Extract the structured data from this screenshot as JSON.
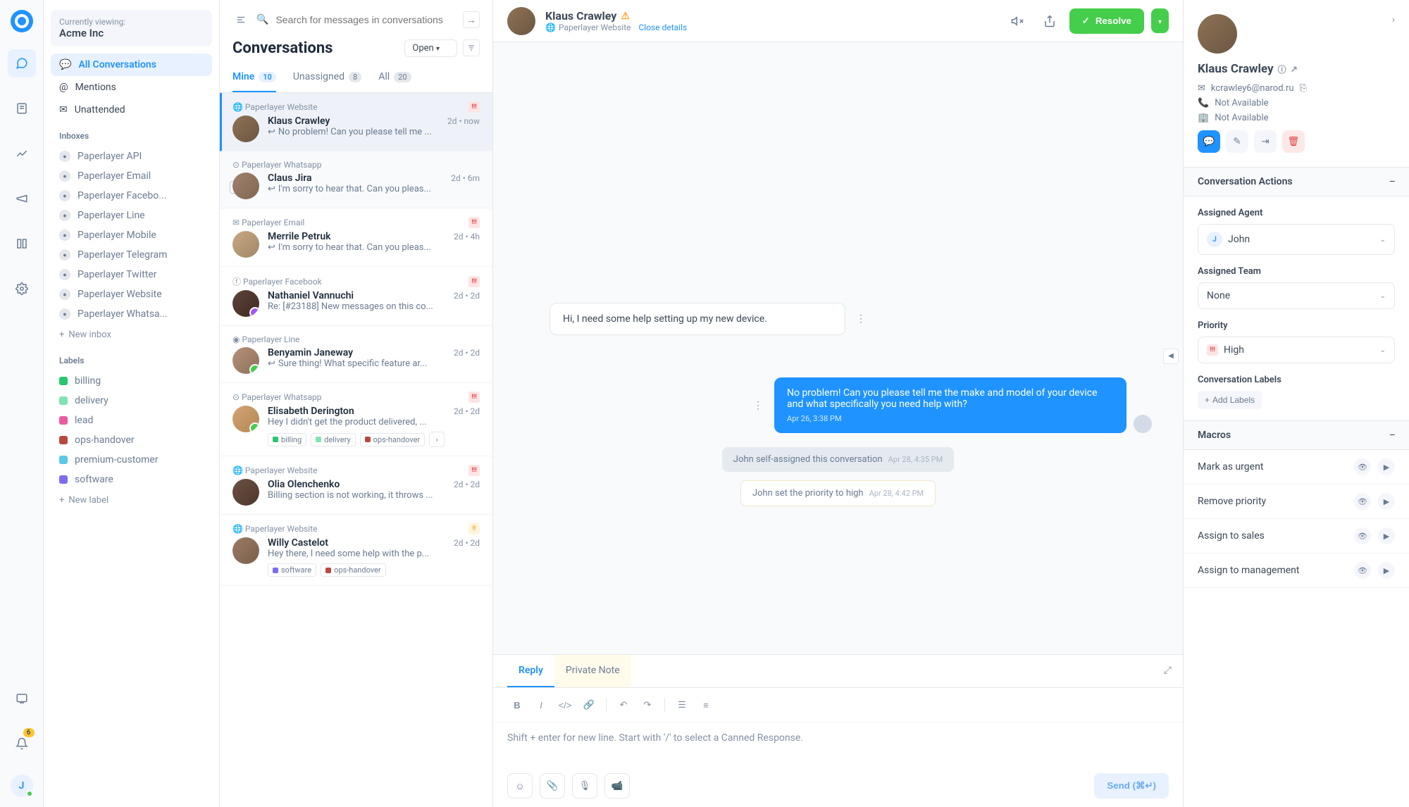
{
  "workspace": {
    "viewing_label": "Currently viewing:",
    "name": "Acme Inc"
  },
  "nav": {
    "all_conversations": "All Conversations",
    "mentions": "Mentions",
    "unattended": "Unattended",
    "inboxes_header": "Inboxes",
    "labels_header": "Labels",
    "new_inbox": "New inbox",
    "new_label": "New label"
  },
  "inboxes": [
    {
      "name": "Paperlayer API",
      "icon": "api"
    },
    {
      "name": "Paperlayer Email",
      "icon": "mail"
    },
    {
      "name": "Paperlayer Facebo...",
      "icon": "fb"
    },
    {
      "name": "Paperlayer Line",
      "icon": "line"
    },
    {
      "name": "Paperlayer Mobile",
      "icon": "mobile"
    },
    {
      "name": "Paperlayer Telegram",
      "icon": "tg"
    },
    {
      "name": "Paperlayer Twitter",
      "icon": "tw"
    },
    {
      "name": "Paperlayer Website",
      "icon": "web"
    },
    {
      "name": "Paperlayer Whatsa...",
      "icon": "wa"
    }
  ],
  "labels": [
    {
      "name": "billing",
      "color": "#28c76f"
    },
    {
      "name": "delivery",
      "color": "#7fe3b5"
    },
    {
      "name": "lead",
      "color": "#ea5b9f"
    },
    {
      "name": "ops-handover",
      "color": "#b74a3c"
    },
    {
      "name": "premium-customer",
      "color": "#59c9e7"
    },
    {
      "name": "software",
      "color": "#7c6cf0"
    }
  ],
  "notif_badge": "6",
  "user_initial": "J",
  "search_placeholder": "Search for messages in conversations",
  "conv_title": "Conversations",
  "status_filter": "Open",
  "tabs": {
    "mine": "Mine",
    "mine_n": "10",
    "unassigned": "Unassigned",
    "unassigned_n": "8",
    "all": "All",
    "all_n": "20"
  },
  "conversations": [
    {
      "channel": "Paperlayer Website",
      "ch_icon": "web",
      "name": "Klaus Crawley",
      "msg": "No problem! Can you please tell me ...",
      "time": "2d • now",
      "reply": true,
      "priority": "high",
      "av": "av-1",
      "active": true
    },
    {
      "channel": "Paperlayer Whatsapp",
      "ch_icon": "wa",
      "name": "Claus Jira",
      "msg": "I'm sorry to hear that. Can you pleas...",
      "time": "2d • 6m",
      "reply": true,
      "av": "av-2",
      "checkbox": true
    },
    {
      "channel": "Paperlayer Email",
      "ch_icon": "mail",
      "name": "Merrile Petruk",
      "msg": "I'm sorry to hear that. Can you pleas...",
      "time": "2d • 4h",
      "reply": true,
      "priority": "high",
      "av": "av-3"
    },
    {
      "channel": "Paperlayer Facebook",
      "ch_icon": "fb",
      "name": "Nathaniel Vannuchi",
      "msg": "Re: [#23188] New messages on this co...",
      "time": "2d • 2d",
      "priority": "high",
      "av": "av-4",
      "badge": "#a259ff"
    },
    {
      "channel": "Paperlayer Line",
      "ch_icon": "line",
      "name": "Benyamin Janeway",
      "msg": "Sure thing! What specific feature ar...",
      "time": "2d • 2d",
      "reply": true,
      "av": "av-5",
      "badge": "#44ce4b"
    },
    {
      "channel": "Paperlayer Whatsapp",
      "ch_icon": "wa",
      "name": "Elisabeth Derington",
      "msg": "Hey I didn't get the product delivered, ...",
      "time": "2d • 2d",
      "priority": "high",
      "av": "av-6",
      "badge": "#44ce4b",
      "labels": [
        {
          "n": "billing",
          "c": "#28c76f"
        },
        {
          "n": "delivery",
          "c": "#7fe3b5"
        },
        {
          "n": "ops-handover",
          "c": "#b74a3c"
        }
      ],
      "more": true
    },
    {
      "channel": "Paperlayer Website",
      "ch_icon": "web",
      "name": "Olia Olenchenko",
      "msg": "Billing section is not working, it throws ...",
      "time": "2d • 2d",
      "priority": "high",
      "av": "av-7"
    },
    {
      "channel": "Paperlayer Website",
      "ch_icon": "web",
      "name": "Willy Castelot",
      "msg": "Hey there, I need some help with the p...",
      "time": "2d • 2d",
      "priority": "med",
      "av": "av-8",
      "labels": [
        {
          "n": "software",
          "c": "#7c6cf0"
        },
        {
          "n": "ops-handover",
          "c": "#b74a3c"
        }
      ]
    }
  ],
  "main": {
    "name": "Klaus Crawley",
    "channel": "Paperlayer Website",
    "close_details": "Close details",
    "resolve": "Resolve",
    "msg_in": "Hi, I need some help setting up my new device.",
    "msg_out": "No problem! Can you please tell me the make and model of your device and what specifically you need help with?",
    "msg_out_ts": "Apr 26, 3:38 PM",
    "sys1": "John self-assigned this conversation",
    "sys1_ts": "Apr 28, 4:35 PM",
    "sys2": "John set the priority to high",
    "sys2_ts": "Apr 28, 4:42 PM"
  },
  "composer": {
    "reply": "Reply",
    "private_note": "Private Note",
    "placeholder": "Shift + enter for new line. Start with '/' to select a Canned Response.",
    "send": "Send (⌘↵)"
  },
  "rpanel": {
    "name": "Klaus Crawley",
    "email": "kcrawley6@narod.ru",
    "phone": "Not Available",
    "company": "Not Available",
    "conv_actions": "Conversation Actions",
    "assigned_agent_lbl": "Assigned Agent",
    "assigned_agent": "John",
    "assigned_team_lbl": "Assigned Team",
    "assigned_team": "None",
    "priority_lbl": "Priority",
    "priority": "High",
    "conv_labels": "Conversation Labels",
    "add_labels": "Add Labels",
    "macros": "Macros",
    "macro_items": [
      "Mark as urgent",
      "Remove priority",
      "Assign to sales",
      "Assign to management"
    ]
  }
}
